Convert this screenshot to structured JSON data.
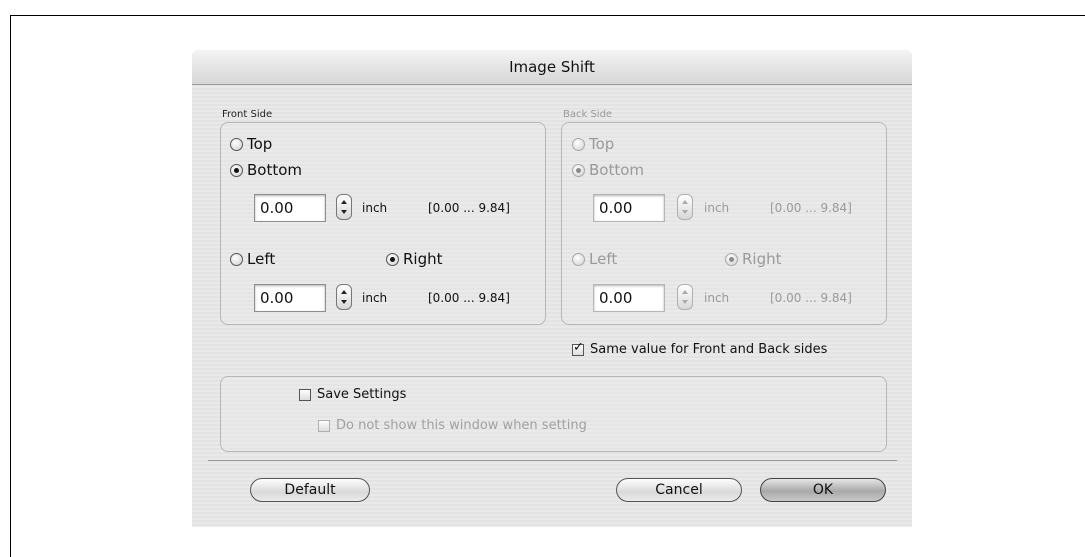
{
  "dialog": {
    "title": "Image Shift"
  },
  "front": {
    "legend": "Front Side",
    "top_label": "Top",
    "bottom_label": "Bottom",
    "vertical_value": "0.00",
    "unit": "inch",
    "range": "[0.00 ... 9.84]",
    "left_label": "Left",
    "right_label": "Right",
    "horizontal_value": "0.00",
    "vertical_selected": "Bottom",
    "horizontal_selected": "Right"
  },
  "back": {
    "legend": "Back Side",
    "top_label": "Top",
    "bottom_label": "Bottom",
    "vertical_value": "0.00",
    "unit": "inch",
    "range": "[0.00 ... 9.84]",
    "left_label": "Left",
    "right_label": "Right",
    "horizontal_value": "0.00",
    "vertical_selected": "Bottom",
    "horizontal_selected": "Right",
    "enabled": false
  },
  "same_value": {
    "label": "Same value for Front and Back sides",
    "checked": true
  },
  "save_settings": {
    "label": "Save Settings",
    "checked": false
  },
  "do_not_show": {
    "label": "Do not show this window when setting",
    "checked": false,
    "enabled": false
  },
  "buttons": {
    "default_label": "Default",
    "cancel_label": "Cancel",
    "ok_label": "OK"
  }
}
